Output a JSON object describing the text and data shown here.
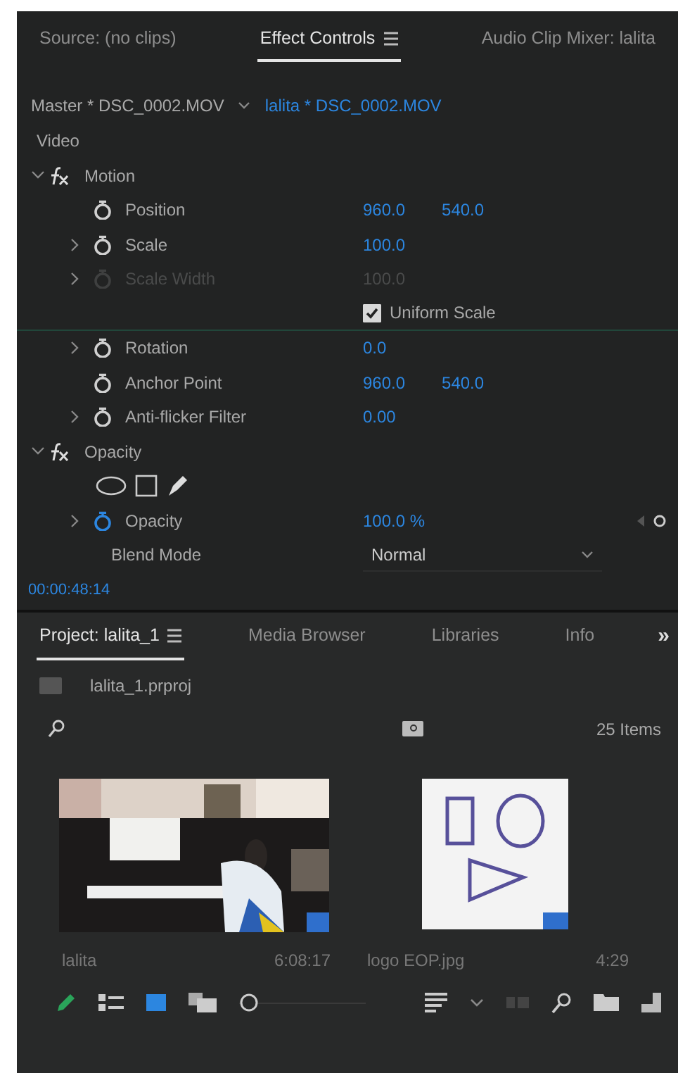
{
  "top_tabs": [
    {
      "label": "Source: (no clips)",
      "selected": false,
      "menu": false
    },
    {
      "label": "Effect Controls",
      "selected": true,
      "menu": true
    },
    {
      "label": "Audio Clip Mixer: lalita",
      "selected": false,
      "menu": false
    }
  ],
  "clip_header": {
    "master": "Master * DSC_0002.MOV",
    "clip": "lalita * DSC_0002.MOV"
  },
  "section": "Video",
  "effects": [
    {
      "name": "Motion",
      "expanded": true,
      "rows": [
        {
          "kind": "param",
          "name": "Position",
          "values": [
            "960.0",
            "540.0"
          ],
          "expandable": false,
          "disabled": false,
          "animated": false
        },
        {
          "kind": "param",
          "name": "Scale",
          "values": [
            "100.0"
          ],
          "expandable": true,
          "disabled": false,
          "animated": false
        },
        {
          "kind": "param",
          "name": "Scale Width",
          "values": [
            "100.0"
          ],
          "expandable": true,
          "disabled": true,
          "animated": false
        },
        {
          "kind": "checkbox",
          "label": "Uniform Scale",
          "checked": true
        },
        {
          "kind": "param",
          "name": "Rotation",
          "values": [
            "0.0"
          ],
          "expandable": true,
          "disabled": false,
          "animated": false
        },
        {
          "kind": "param",
          "name": "Anchor Point",
          "values": [
            "960.0",
            "540.0"
          ],
          "expandable": false,
          "disabled": false,
          "animated": false
        },
        {
          "kind": "param",
          "name": "Anti-flicker Filter",
          "values": [
            "0.00"
          ],
          "expandable": true,
          "disabled": false,
          "animated": false
        }
      ]
    },
    {
      "name": "Opacity",
      "expanded": true,
      "rows": [
        {
          "kind": "mask_tools"
        },
        {
          "kind": "param",
          "name": "Opacity",
          "values": [
            "100.0 %"
          ],
          "expandable": true,
          "disabled": false,
          "animated": true
        },
        {
          "kind": "dropdown",
          "name": "Blend Mode",
          "value": "Normal"
        }
      ]
    }
  ],
  "timecode": "00:00:48:14",
  "project_tabs": [
    {
      "label": "Project: lalita_1",
      "selected": true,
      "menu": true
    },
    {
      "label": "Media Browser",
      "selected": false,
      "menu": false
    },
    {
      "label": "Libraries",
      "selected": false,
      "menu": false
    },
    {
      "label": "Info",
      "selected": false,
      "menu": false
    }
  ],
  "overflow": "»",
  "project_file": "lalita_1.prproj",
  "item_count": "25 Items",
  "media": [
    {
      "name": "lalita",
      "duration": "6:08:17",
      "kind": "video"
    },
    {
      "name": "logo EOP.jpg",
      "duration": "4:29"
    }
  ]
}
